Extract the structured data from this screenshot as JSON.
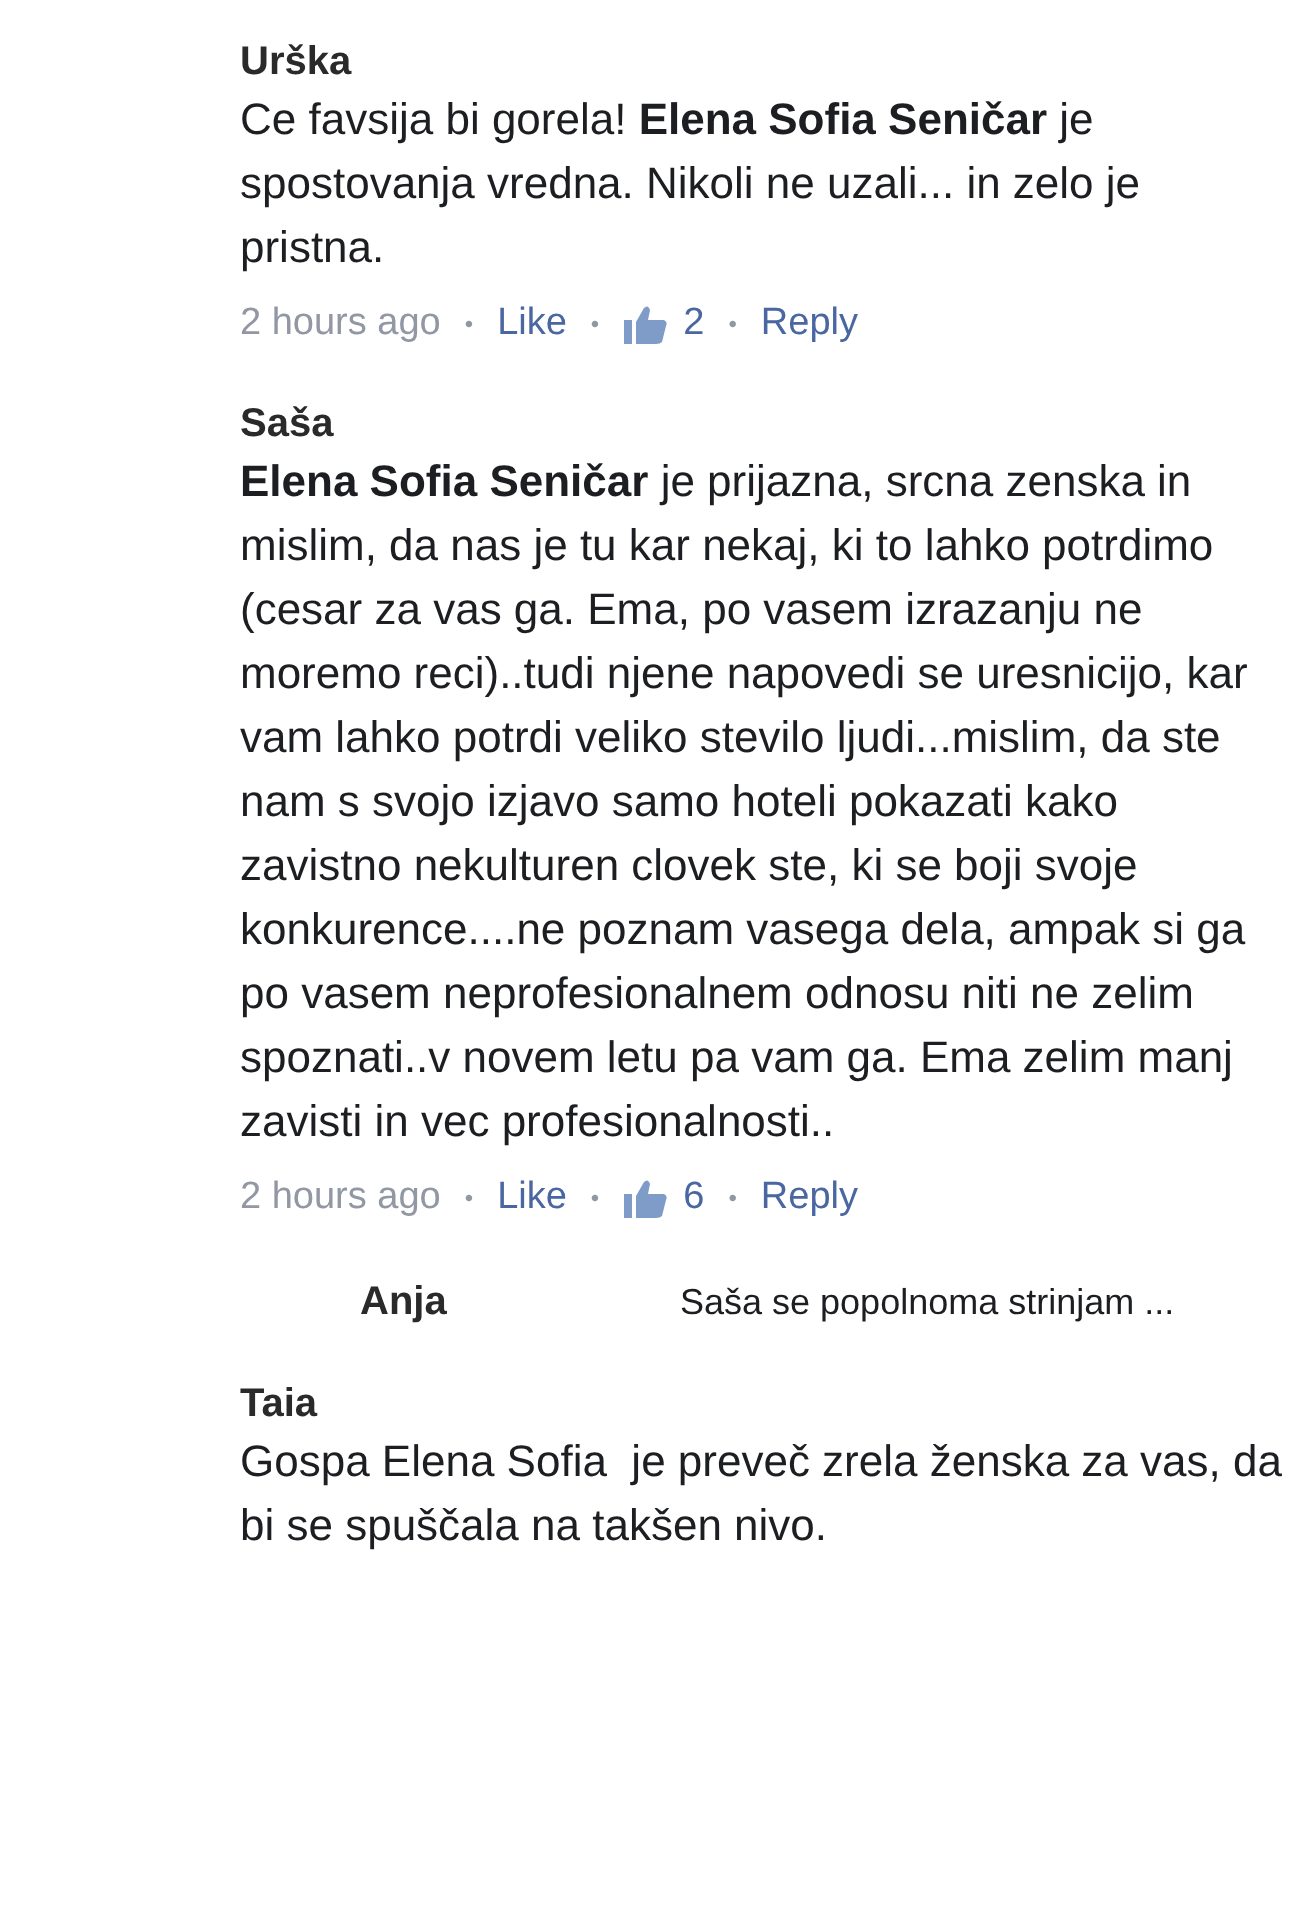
{
  "comments": [
    {
      "kind": "comment",
      "author": "Urška",
      "text": "Ce favsija bi gorela! **Elena Sofia Seničar** je spostovanja vredna. Nikoli ne uzali... in zelo je pristna.",
      "time": "2 hours ago",
      "separator": "•",
      "like": "Like",
      "likes": "2",
      "reply": "Reply"
    },
    {
      "kind": "comment",
      "author": "Saša",
      "text": "**Elena Sofia Seničar** je prijazna, srcna zenska in mislim, da nas je tu kar nekaj, ki to lahko potrdimo (cesar za vas ga. Ema, po vasem izrazanju ne moremo reci)..tudi njene napovedi se uresnicijo, kar vam lahko potrdi veliko stevilo ljudi...mislim, da ste nam s svojo izjavo samo hoteli pokazati kako zavistno nekulturen clovek ste, ki se boji svoje konkurence....ne poznam vasega dela, ampak si ga po vasem neprofesionalnem odnosu niti ne zelim spoznati..v novem letu pa vam ga. Ema zelim manj zavisti in vec profesionalnosti..",
      "time": "2 hours ago",
      "separator": "•",
      "like": "Like",
      "likes": "6",
      "reply": "Reply"
    },
    {
      "kind": "reply",
      "author": "Anja",
      "text": "Saša se popolnoma strinjam ..."
    },
    {
      "kind": "comment",
      "author": "Taia",
      "text": "Gospa Elena Sofia  je preveč zrela ženska za vas, da bi se spuščala na takšen nivo."
    }
  ]
}
